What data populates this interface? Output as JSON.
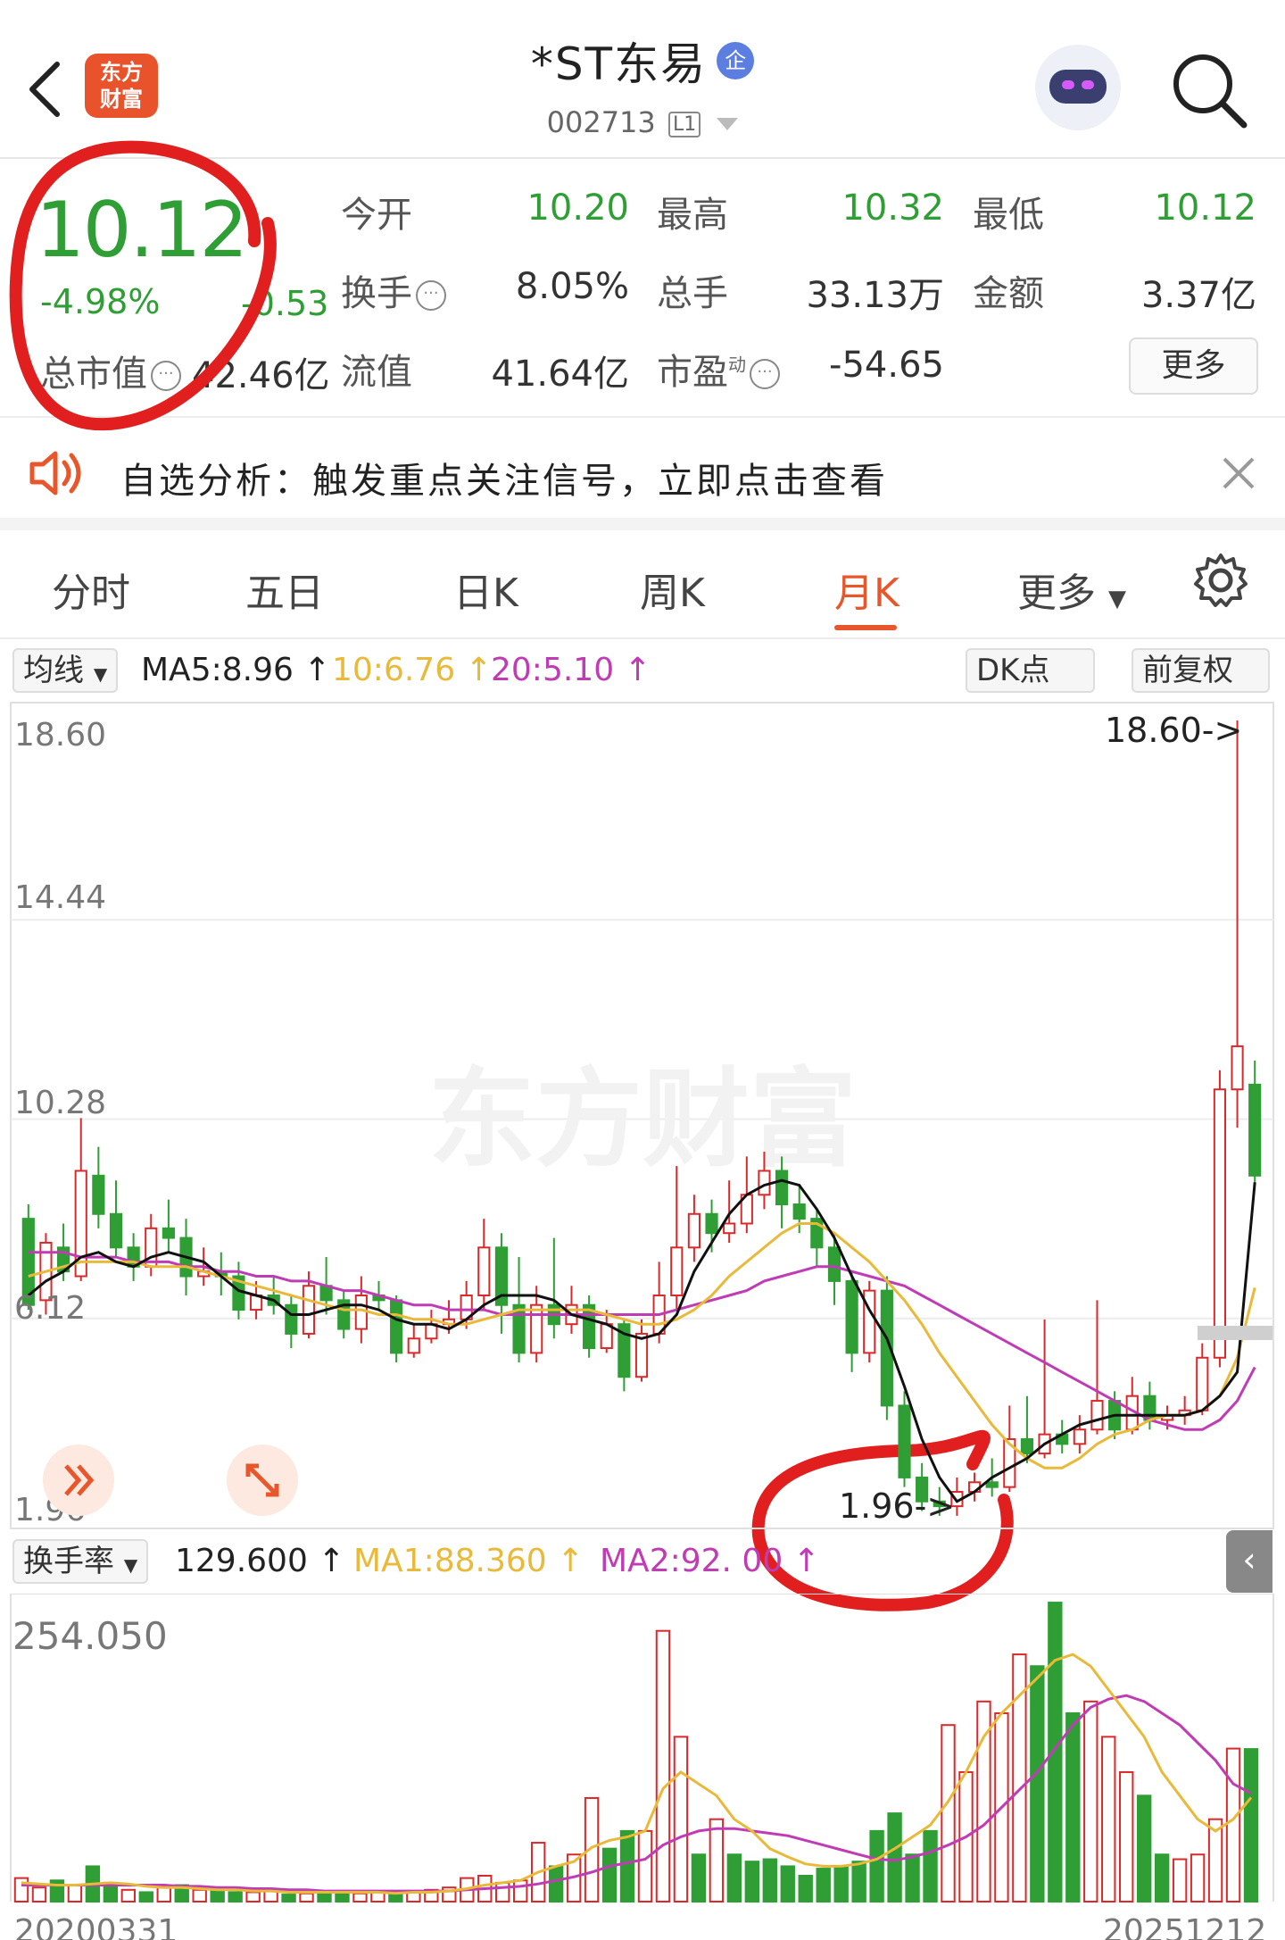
{
  "header": {
    "back_icon": "chevron-left-icon",
    "logo_line1": "东方",
    "logo_line2": "财富",
    "title": "*ST东易",
    "badge": "企",
    "code": "002713",
    "level": "L1",
    "search_icon": "search-icon"
  },
  "quote": {
    "price": "10.12",
    "change_pct": "-4.98%",
    "change": "-0.53",
    "market_value_label": "总市值",
    "market_value": "42.46亿",
    "open_label": "今开",
    "open": "10.20",
    "high_label": "最高",
    "high": "10.32",
    "low_label": "最低",
    "low": "10.12",
    "turnover_label": "换手",
    "turnover": "8.05%",
    "volume_label": "总手",
    "volume": "33.13万",
    "amount_label": "金额",
    "amount": "3.37亿",
    "float_label": "流值",
    "float_value": "41.64亿",
    "pe_label": "市盈",
    "pe_super": "动",
    "pe": "-54.65",
    "more": "更多",
    "up_color": "#d9292b",
    "down_color": "#2e9e35"
  },
  "notice": {
    "text": "自选分析：触发重点关注信号，立即点击查看",
    "close_icon": "close-icon"
  },
  "tabs": [
    {
      "label": "分时"
    },
    {
      "label": "五日"
    },
    {
      "label": "日K"
    },
    {
      "label": "周K"
    },
    {
      "label": "月K"
    },
    {
      "label": "更多"
    }
  ],
  "ma_bar": {
    "selector": "均线",
    "ma5": "MA5:8.96",
    "ma10": "10:6.76",
    "ma20": "20:5.10",
    "dk": "DK点",
    "adjust": "前复权"
  },
  "kline": {
    "y_labels": [
      "18.60",
      "14.44",
      "10.28",
      "6.12",
      "1.96"
    ],
    "max_marker": "18.60->",
    "min_marker": "1.96->",
    "watermark": "东方财富"
  },
  "vol_bar": {
    "selector": "换手率",
    "value": "129.600",
    "ma1": "MA1:88.360",
    "ma2": "MA2:92.  00",
    "side_icon": "chevron-left-icon"
  },
  "volume": {
    "top_label": "254.050",
    "start_date": "20200331",
    "end_date": "20251212"
  },
  "chart_data": {
    "type": "candlestick",
    "ylim": [
      1.96,
      18.6
    ],
    "colors": {
      "up": "#d9292b",
      "down": "#2e9e35",
      "ma5": "#111111",
      "ma10": "#e9b93a",
      "ma20": "#c03cb5"
    },
    "candles": [
      [
        8.2,
        6.4,
        8.5,
        6.3
      ],
      [
        6.5,
        7.7,
        7.9,
        6.2
      ],
      [
        7.6,
        7.1,
        8.1,
        6.9
      ],
      [
        7.0,
        9.2,
        10.3,
        6.9
      ],
      [
        9.1,
        8.3,
        9.7,
        8.0
      ],
      [
        8.3,
        7.6,
        9.0,
        7.4
      ],
      [
        7.6,
        7.2,
        7.9,
        6.9
      ],
      [
        7.2,
        8.0,
        8.3,
        7.0
      ],
      [
        8.0,
        7.8,
        8.6,
        7.5
      ],
      [
        7.8,
        7.0,
        8.2,
        6.6
      ],
      [
        7.0,
        7.1,
        7.6,
        6.8
      ],
      [
        7.1,
        7.0,
        7.5,
        6.6
      ],
      [
        7.0,
        6.3,
        7.3,
        6.1
      ],
      [
        6.3,
        6.6,
        6.9,
        6.1
      ],
      [
        6.6,
        6.4,
        7.0,
        6.2
      ],
      [
        6.4,
        5.8,
        6.6,
        5.5
      ],
      [
        5.8,
        6.8,
        7.1,
        5.7
      ],
      [
        6.8,
        6.5,
        7.4,
        6.2
      ],
      [
        6.5,
        5.9,
        6.7,
        5.7
      ],
      [
        5.9,
        6.6,
        7.0,
        5.6
      ],
      [
        6.6,
        6.5,
        6.9,
        6.3
      ],
      [
        6.5,
        5.4,
        6.6,
        5.2
      ],
      [
        5.4,
        5.7,
        6.0,
        5.3
      ],
      [
        5.7,
        6.0,
        6.3,
        5.6
      ],
      [
        6.0,
        6.1,
        6.5,
        5.8
      ],
      [
        6.1,
        6.6,
        6.9,
        5.9
      ],
      [
        6.6,
        7.6,
        8.2,
        6.3
      ],
      [
        7.6,
        6.4,
        7.9,
        5.8
      ],
      [
        6.4,
        5.4,
        7.4,
        5.2
      ],
      [
        5.4,
        6.4,
        6.8,
        5.2
      ],
      [
        6.4,
        6.0,
        7.8,
        5.7
      ],
      [
        6.0,
        6.4,
        6.8,
        5.8
      ],
      [
        6.4,
        5.5,
        6.6,
        5.3
      ],
      [
        5.5,
        6.0,
        6.3,
        5.4
      ],
      [
        6.0,
        4.9,
        6.1,
        4.6
      ],
      [
        4.9,
        5.8,
        6.1,
        4.8
      ],
      [
        5.8,
        6.6,
        7.3,
        5.6
      ],
      [
        6.6,
        7.6,
        9.3,
        6.3
      ],
      [
        7.6,
        8.3,
        8.7,
        7.3
      ],
      [
        8.3,
        7.9,
        8.6,
        7.5
      ],
      [
        7.9,
        8.1,
        9.0,
        7.7
      ],
      [
        8.1,
        8.7,
        9.5,
        7.9
      ],
      [
        8.7,
        9.2,
        9.6,
        8.4
      ],
      [
        9.2,
        8.5,
        9.5,
        8.0
      ],
      [
        8.5,
        8.2,
        8.9,
        7.9
      ],
      [
        8.2,
        7.6,
        8.4,
        7.2
      ],
      [
        7.6,
        6.9,
        7.9,
        6.4
      ],
      [
        6.9,
        5.4,
        7.1,
        5.0
      ],
      [
        5.4,
        6.7,
        6.9,
        5.2
      ],
      [
        6.7,
        4.3,
        7.0,
        4.0
      ],
      [
        4.3,
        2.8,
        4.6,
        2.6
      ],
      [
        2.8,
        2.3,
        3.1,
        2.1
      ],
      [
        2.3,
        2.2,
        2.6,
        2.0
      ],
      [
        2.2,
        2.5,
        2.8,
        2.0
      ],
      [
        2.5,
        2.7,
        2.9,
        2.3
      ],
      [
        2.7,
        2.6,
        3.2,
        2.4
      ],
      [
        2.6,
        3.6,
        4.3,
        2.5
      ],
      [
        3.6,
        3.3,
        4.5,
        3.1
      ],
      [
        3.3,
        3.7,
        6.1,
        3.2
      ],
      [
        3.7,
        3.5,
        4.0,
        3.3
      ],
      [
        3.5,
        3.8,
        4.1,
        3.3
      ],
      [
        3.8,
        4.4,
        6.5,
        3.7
      ],
      [
        4.4,
        3.8,
        4.6,
        3.6
      ],
      [
        3.8,
        4.5,
        4.9,
        3.7
      ],
      [
        4.5,
        4.0,
        4.8,
        3.8
      ],
      [
        4.0,
        4.1,
        4.3,
        3.8
      ],
      [
        4.1,
        4.2,
        4.5,
        3.9
      ],
      [
        4.2,
        5.3,
        5.6,
        4.1
      ],
      [
        5.3,
        10.9,
        11.3,
        5.1
      ],
      [
        10.9,
        11.8,
        18.6,
        10.1
      ],
      [
        11.0,
        9.1,
        11.5,
        8.9
      ]
    ],
    "ma5": [
      6.6,
      6.9,
      7.1,
      7.4,
      7.5,
      7.3,
      7.2,
      7.4,
      7.5,
      7.4,
      7.3,
      7.0,
      6.7,
      6.6,
      6.5,
      6.2,
      6.2,
      6.3,
      6.4,
      6.4,
      6.3,
      6.1,
      6.0,
      6.0,
      5.9,
      6.1,
      6.4,
      6.6,
      6.6,
      6.6,
      6.5,
      6.2,
      6.1,
      6.0,
      5.8,
      5.7,
      5.8,
      6.2,
      7.1,
      7.7,
      8.3,
      8.7,
      8.9,
      9.0,
      8.9,
      8.4,
      7.8,
      7.0,
      6.3,
      5.7,
      4.7,
      3.6,
      2.8,
      2.3,
      2.5,
      2.8,
      3.0,
      3.2,
      3.5,
      3.7,
      3.9,
      4.0,
      4.1,
      4.1,
      4.1,
      4.1,
      4.1,
      4.2,
      4.5,
      5.0,
      8.96
    ],
    "ma10": [
      7.0,
      7.1,
      7.2,
      7.3,
      7.3,
      7.3,
      7.3,
      7.2,
      7.2,
      7.2,
      7.1,
      7.0,
      6.9,
      6.8,
      6.7,
      6.6,
      6.5,
      6.4,
      6.3,
      6.3,
      6.2,
      6.2,
      6.1,
      6.1,
      6.0,
      6.0,
      6.1,
      6.2,
      6.3,
      6.3,
      6.3,
      6.3,
      6.3,
      6.2,
      6.1,
      6.0,
      6.0,
      6.1,
      6.3,
      6.6,
      7.0,
      7.3,
      7.6,
      7.9,
      8.1,
      8.1,
      7.9,
      7.6,
      7.3,
      6.9,
      6.5,
      6.0,
      5.4,
      4.9,
      4.4,
      3.9,
      3.5,
      3.2,
      3.0,
      3.0,
      3.2,
      3.5,
      3.7,
      3.8,
      4.0,
      4.1,
      4.1,
      4.2,
      4.5,
      5.3,
      6.76
    ],
    "ma20": [
      7.5,
      7.5,
      7.5,
      7.4,
      7.4,
      7.4,
      7.3,
      7.3,
      7.3,
      7.2,
      7.2,
      7.1,
      7.1,
      7.0,
      7.0,
      6.9,
      6.9,
      6.8,
      6.7,
      6.7,
      6.6,
      6.5,
      6.4,
      6.4,
      6.3,
      6.3,
      6.3,
      6.2,
      6.2,
      6.2,
      6.2,
      6.2,
      6.2,
      6.2,
      6.2,
      6.2,
      6.2,
      6.3,
      6.4,
      6.5,
      6.6,
      6.7,
      6.9,
      7.0,
      7.1,
      7.2,
      7.2,
      7.1,
      7.0,
      6.9,
      6.8,
      6.6,
      6.4,
      6.2,
      6.0,
      5.8,
      5.6,
      5.4,
      5.2,
      5.0,
      4.8,
      4.6,
      4.4,
      4.2,
      4.0,
      3.9,
      3.8,
      3.8,
      4.0,
      4.4,
      5.1
    ],
    "turnover": {
      "ylim": [
        0,
        254.05
      ],
      "values": [
        20,
        12,
        18,
        14,
        30,
        16,
        10,
        8,
        12,
        14,
        10,
        9,
        8,
        8,
        10,
        6,
        7,
        8,
        9,
        7,
        8,
        6,
        9,
        10,
        12,
        20,
        22,
        16,
        18,
        50,
        30,
        40,
        88,
        45,
        60,
        60,
        230,
        140,
        40,
        70,
        40,
        34,
        36,
        30,
        22,
        28,
        30,
        34,
        60,
        75,
        40,
        60,
        150,
        110,
        170,
        160,
        210,
        200,
        254,
        160,
        170,
        140,
        110,
        90,
        40,
        36,
        40,
        70,
        130,
        129.6
      ],
      "up_flags": [
        1,
        1,
        0,
        1,
        0,
        0,
        1,
        0,
        1,
        0,
        1,
        0,
        0,
        1,
        1,
        0,
        1,
        0,
        0,
        1,
        1,
        0,
        1,
        1,
        1,
        1,
        1,
        1,
        1,
        1,
        0,
        1,
        1,
        0,
        0,
        1,
        1,
        1,
        0,
        1,
        0,
        0,
        0,
        0,
        0,
        0,
        0,
        0,
        0,
        0,
        0,
        0,
        1,
        1,
        1,
        1,
        1,
        0,
        0,
        0,
        1,
        1,
        1,
        0,
        0,
        1,
        1,
        1,
        1,
        0
      ],
      "ma1": [
        16,
        15,
        14,
        14,
        15,
        16,
        15,
        13,
        12,
        12,
        11,
        10,
        10,
        9,
        9,
        8,
        8,
        8,
        8,
        8,
        8,
        7,
        8,
        8,
        9,
        11,
        14,
        16,
        18,
        25,
        30,
        34,
        46,
        52,
        55,
        60,
        96,
        110,
        100,
        90,
        70,
        60,
        45,
        38,
        32,
        30,
        30,
        32,
        36,
        45,
        55,
        65,
        85,
        110,
        140,
        160,
        175,
        190,
        205,
        210,
        200,
        180,
        160,
        140,
        110,
        90,
        70,
        60,
        70,
        88.36
      ],
      "ma2": [
        14,
        14,
        14,
        14,
        14,
        14,
        14,
        14,
        14,
        13,
        13,
        12,
        12,
        11,
        11,
        10,
        10,
        9,
        9,
        9,
        9,
        9,
        9,
        9,
        9,
        10,
        11,
        12,
        13,
        15,
        18,
        21,
        25,
        30,
        33,
        36,
        48,
        55,
        60,
        62,
        62,
        60,
        58,
        56,
        52,
        48,
        44,
        40,
        36,
        35,
        38,
        42,
        48,
        55,
        65,
        80,
        95,
        110,
        130,
        150,
        165,
        172,
        175,
        170,
        160,
        150,
        135,
        120,
        100,
        92
      ]
    }
  }
}
